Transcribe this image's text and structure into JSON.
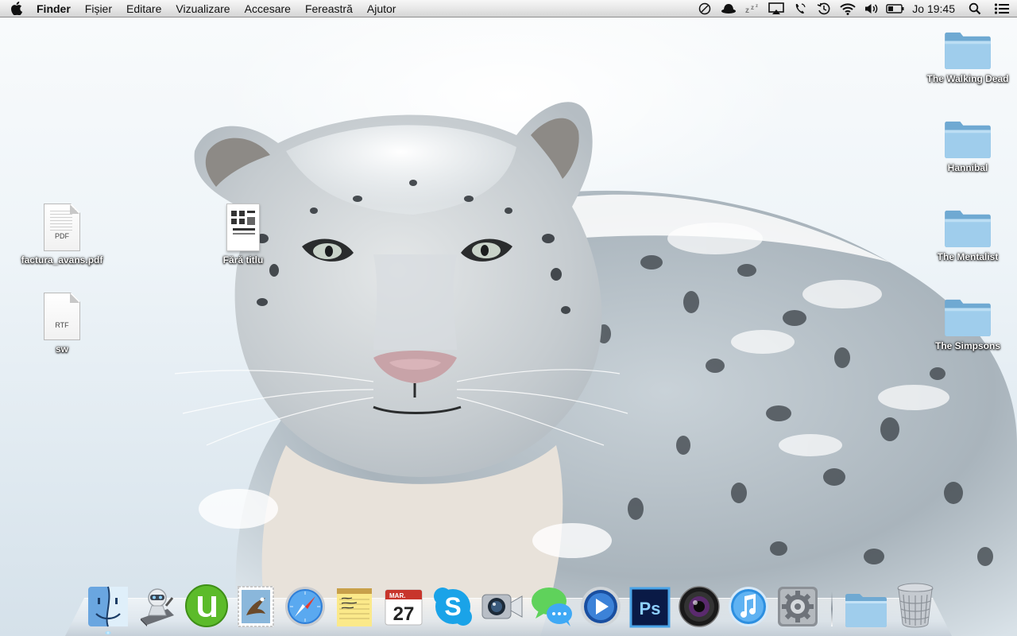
{
  "menubar": {
    "apple_icon": "apple-logo-icon",
    "app_name": "Finder",
    "menus": [
      "Fișier",
      "Editare",
      "Vizualizare",
      "Accesare",
      "Fereastră",
      "Ajutor"
    ],
    "status_icons": [
      "do-not-disturb-icon",
      "hat-icon",
      "sleep-icon",
      "airplay-icon",
      "phone-icon",
      "time-machine-icon",
      "wifi-icon",
      "volume-icon",
      "battery-icon"
    ],
    "clock": "Jo 19:45",
    "spotlight_icon": "spotlight-search-icon",
    "notification_icon": "notification-center-icon"
  },
  "desktop": {
    "files": [
      {
        "label": "factura_avans.pdf",
        "type_tag": "PDF"
      },
      {
        "label": "sw",
        "type_tag": "RTF"
      },
      {
        "label": "Fără titlu",
        "type_tag": ""
      }
    ],
    "folders": [
      {
        "label": "The Walking Dead"
      },
      {
        "label": "Hannibal"
      },
      {
        "label": "The Mentalist"
      },
      {
        "label": "The Simpsons"
      }
    ]
  },
  "dock": {
    "apps": [
      {
        "name": "Finder",
        "icon": "finder-icon",
        "running": true
      },
      {
        "name": "Automator",
        "icon": "automator-icon",
        "running": false
      },
      {
        "name": "uTorrent",
        "icon": "utorrent-icon",
        "running": false
      },
      {
        "name": "Mail",
        "icon": "mail-stamp-icon",
        "running": false
      },
      {
        "name": "Safari",
        "icon": "safari-compass-icon",
        "running": false
      },
      {
        "name": "Notes",
        "icon": "notes-icon",
        "running": false
      },
      {
        "name": "Calendar",
        "icon": "calendar-icon",
        "running": false,
        "month": "MAR.",
        "day": "27"
      },
      {
        "name": "Skype",
        "icon": "skype-icon",
        "running": false
      },
      {
        "name": "FaceTime",
        "icon": "facetime-camera-icon",
        "running": false
      },
      {
        "name": "Messages",
        "icon": "messages-bubble-icon",
        "running": false
      },
      {
        "name": "QuickTime",
        "icon": "quicktime-icon",
        "running": false
      },
      {
        "name": "Photoshop",
        "icon": "photoshop-icon",
        "running": false,
        "text": "Ps"
      },
      {
        "name": "Photo Booth",
        "icon": "camera-lens-icon",
        "running": false
      },
      {
        "name": "iTunes",
        "icon": "itunes-note-icon",
        "running": false
      },
      {
        "name": "System Preferences",
        "icon": "gear-icon",
        "running": false
      }
    ],
    "stack_folder_icon": "stack-folder-icon",
    "trash_icon": "trash-icon"
  },
  "colors": {
    "menubar": "#e6e6e6",
    "folder_blue": "#8ec4e6",
    "utorrent_green": "#5cbb2a",
    "skype_blue": "#1aa3e8",
    "photoshop_navy": "#0a1a46"
  }
}
